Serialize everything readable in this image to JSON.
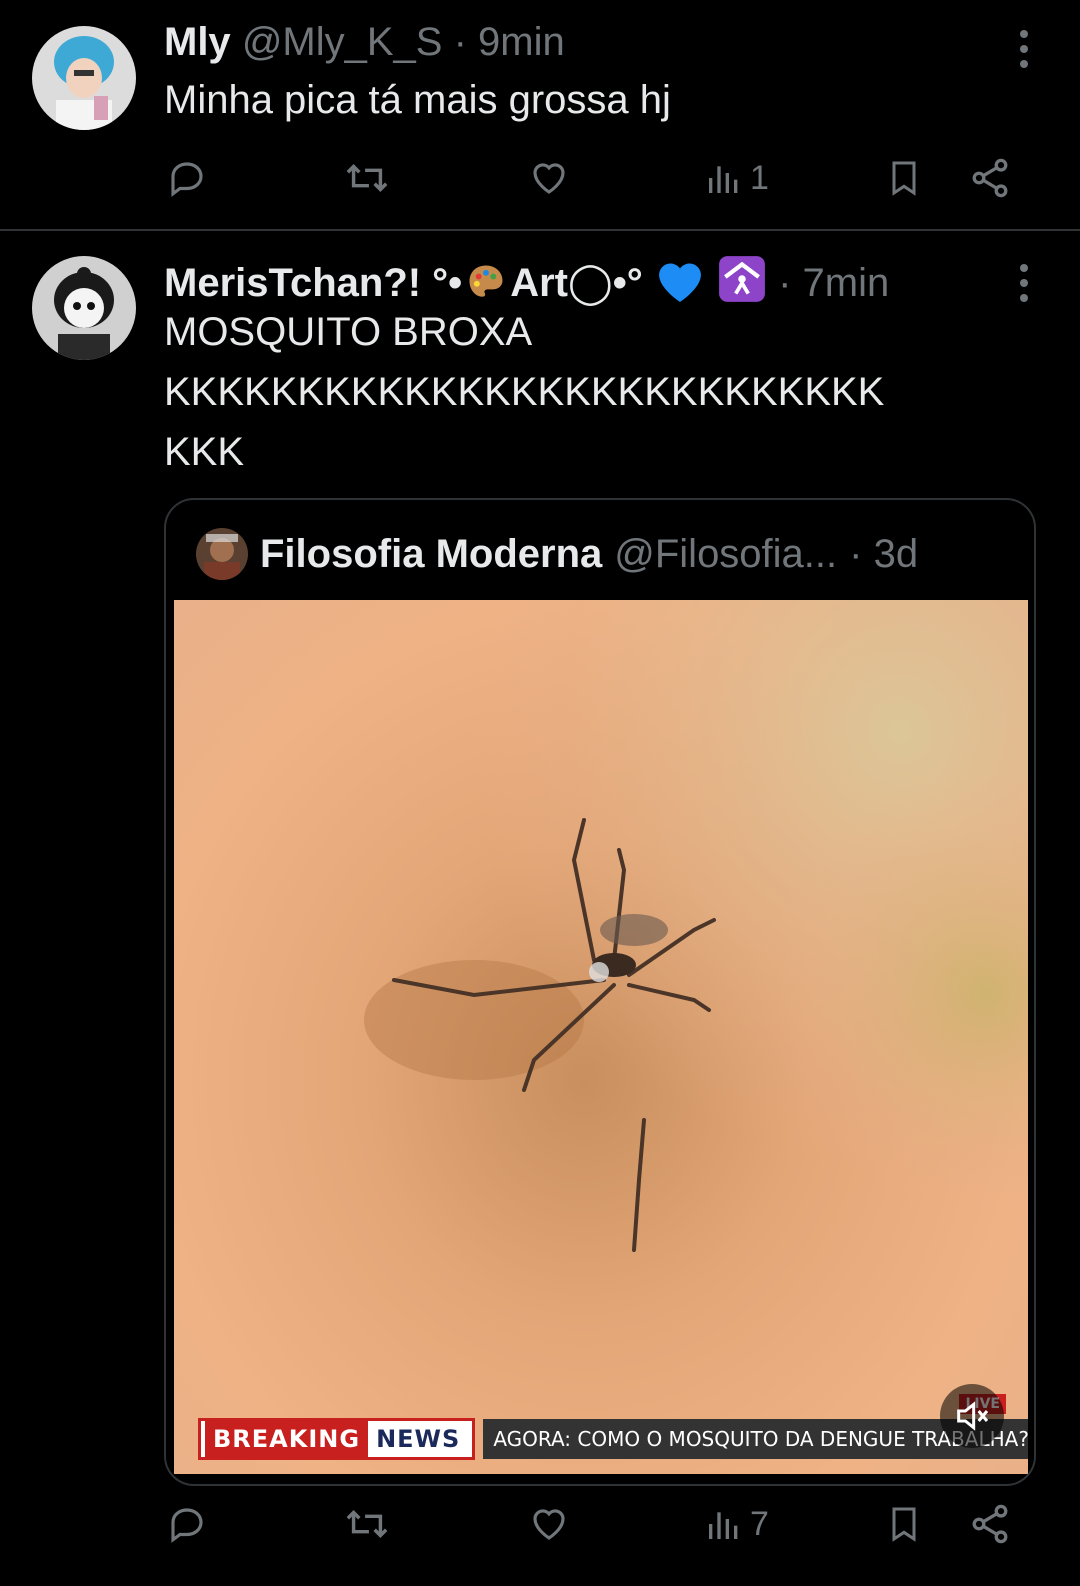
{
  "tweet1": {
    "name": "Mly",
    "handle": "@Mly_K_S",
    "time": "· 9min",
    "text": "Minha pica tá mais grossa hj",
    "views": "1"
  },
  "tweet2": {
    "name": "MerisTchan?! °•",
    "name_part2": "Art",
    "name_part3": "◯•°",
    "time": "· 7min",
    "text_line1": "MOSQUITO BROXA",
    "text_line2": "KKKKKKKKKKKKKKKKKKKKKKKKKKK",
    "text_line3": "KKK",
    "views": "7",
    "quote": {
      "name": "Filosofia Moderna",
      "handle": "@Filosofia...",
      "time": "· 3d",
      "video": {
        "badge_breaking": "BREAKING",
        "badge_news": "NEWS",
        "headline": "AGORA: COMO O MOSQUITO DA DENGUE TRABALHA?",
        "live": "LIVE"
      }
    }
  },
  "icons": {
    "reply": "reply-icon",
    "retweet": "retweet-icon",
    "like": "heart-icon",
    "views": "views-icon",
    "bookmark": "bookmark-icon",
    "share": "share-icon",
    "more": "more-icon",
    "mute": "mute-icon"
  },
  "colors": {
    "background": "#000000",
    "text": "#e7e9ea",
    "muted": "#71767b",
    "divider": "#2f3336",
    "breaking_red": "#c8201f"
  }
}
